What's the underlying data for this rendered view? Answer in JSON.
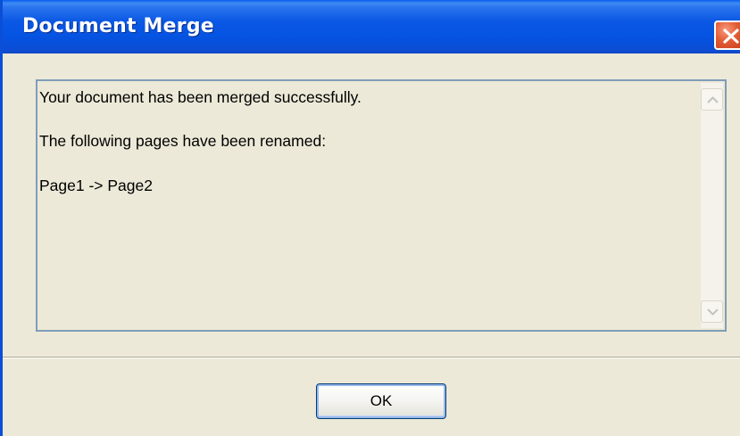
{
  "dialog": {
    "title": "Document Merge",
    "message_lines": [
      "Your document has been merged successfully.",
      "The following pages have been renamed:",
      "Page1 -> Page2"
    ],
    "ok_label": "OK"
  },
  "icons": {
    "close": "close-icon",
    "scroll_up": "scroll-up-arrow-icon",
    "scroll_down": "scroll-down-arrow-icon"
  },
  "colors": {
    "title_bar": "#0a58e4",
    "close_button": "#e35b33",
    "window_background": "#ece9d8",
    "text_area_border": "#7f9db9",
    "ok_button_border": "#003c74"
  }
}
